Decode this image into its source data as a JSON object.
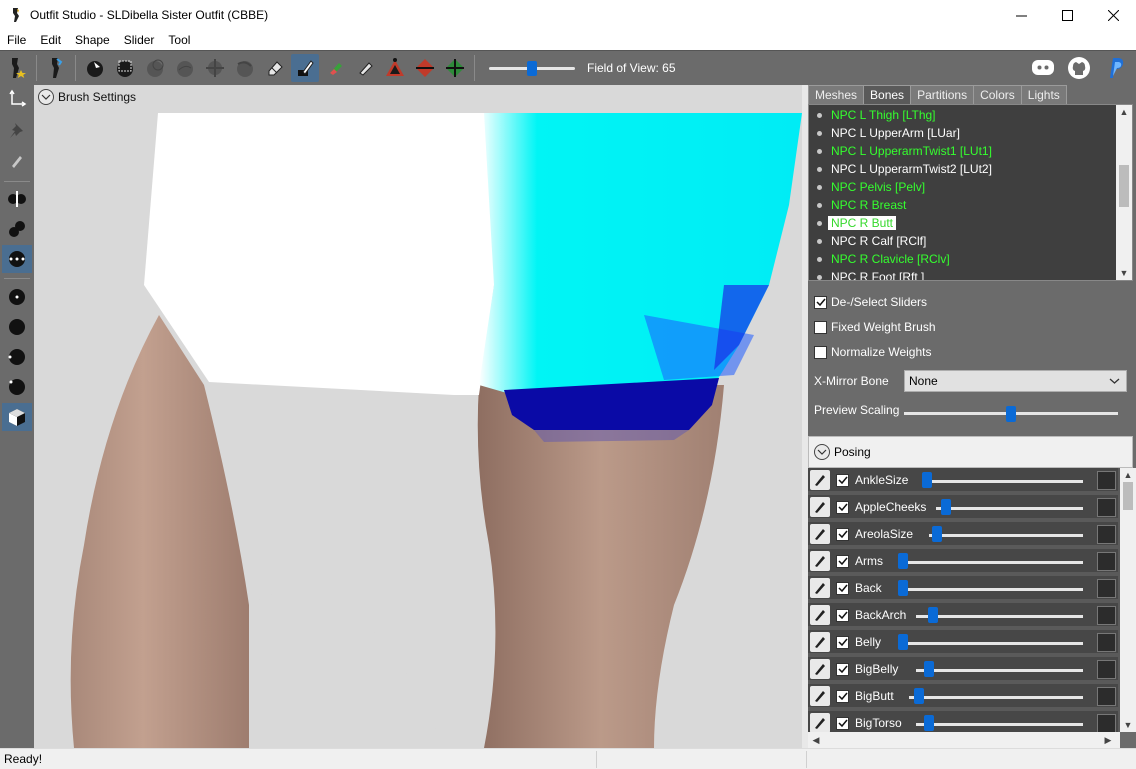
{
  "window": {
    "title": "Outfit Studio - SLDibella Sister Outfit (CBBE)",
    "minimize": "—",
    "maximize": "☐",
    "close": "✕"
  },
  "menu": [
    "File",
    "Edit",
    "Shape",
    "Slider",
    "Tool"
  ],
  "toolbar": {
    "field_of_view_label": "Field of View: 65",
    "field_of_view_value": 65,
    "accent": "#0a6ad6"
  },
  "viewport": {
    "brush_settings_label": "Brush Settings"
  },
  "tabs": [
    "Meshes",
    "Bones",
    "Partitions",
    "Colors",
    "Lights"
  ],
  "active_tab": "Bones",
  "bones": [
    {
      "name": "NPC L Thigh [LThg]",
      "color": "green"
    },
    {
      "name": "NPC L UpperArm [LUar]",
      "color": "white"
    },
    {
      "name": "NPC L UpperarmTwist1 [LUt1]",
      "color": "green"
    },
    {
      "name": "NPC L UpperarmTwist2 [LUt2]",
      "color": "white"
    },
    {
      "name": "NPC Pelvis [Pelv]",
      "color": "green"
    },
    {
      "name": "NPC R Breast",
      "color": "green"
    },
    {
      "name": "NPC R Butt",
      "color": "selected"
    },
    {
      "name": "NPC R Calf [RClf]",
      "color": "white"
    },
    {
      "name": "NPC R Clavicle [RClv]",
      "color": "green"
    },
    {
      "name": "NPC R Foot [Rft ]",
      "color": "white"
    }
  ],
  "options": {
    "deselect_sliders": "De-/Select Sliders",
    "fixed_weight_brush": "Fixed Weight Brush",
    "normalize_weights": "Normalize Weights",
    "x_mirror_bone_label": "X-Mirror Bone",
    "x_mirror_bone_value": "None",
    "preview_scaling_label": "Preview Scaling",
    "preview_scaling_fraction": 0.5
  },
  "posing_label": "Posing",
  "sliders": [
    {
      "name": "AnkleSize",
      "fraction": 0.0
    },
    {
      "name": "AppleCheeks",
      "fraction": 0.04
    },
    {
      "name": "AreolaSize",
      "fraction": 0.02
    },
    {
      "name": "Arms",
      "fraction": 0.0
    },
    {
      "name": "Back",
      "fraction": 0.0
    },
    {
      "name": "BackArch",
      "fraction": 0.07
    },
    {
      "name": "Belly",
      "fraction": 0.0
    },
    {
      "name": "BigBelly",
      "fraction": 0.05
    },
    {
      "name": "BigButt",
      "fraction": 0.03
    },
    {
      "name": "BigTorso",
      "fraction": 0.05
    }
  ],
  "status": "Ready!"
}
